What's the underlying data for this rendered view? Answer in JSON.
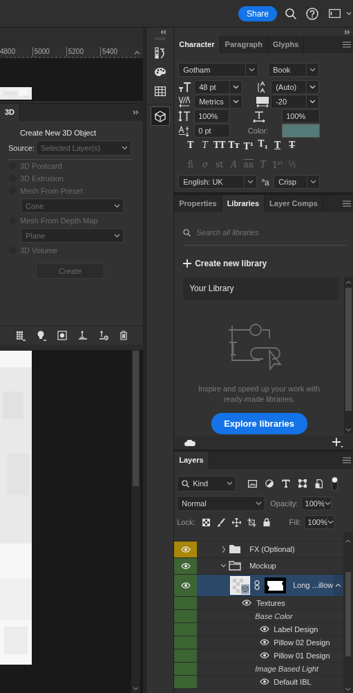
{
  "top_bar": {
    "share_button": "Share"
  },
  "document": {
    "ruler_ticks": [
      "4800",
      "5000",
      "5200",
      "5400"
    ]
  },
  "panel_3d": {
    "tab": "3D",
    "heading": "Create New 3D Object",
    "source_label": "Source:",
    "source": "Selected Layer(s)",
    "disabled": true,
    "options": [
      {
        "label": "3D Postcard",
        "selected": false
      },
      {
        "label": "3D Extrusion",
        "selected": false
      },
      {
        "label": "Mesh From Preset",
        "selected": false,
        "dropdown": "Cone"
      },
      {
        "label": "Mesh From Depth Map",
        "selected": false,
        "dropdown": "Plane"
      },
      {
        "label": "3D Volume",
        "selected": false
      }
    ],
    "create_button": "Create"
  },
  "dock": {
    "items": [
      {
        "kind": "history",
        "selected": false
      },
      {
        "kind": "swatches",
        "selected": false
      },
      {
        "kind": "grid",
        "selected": false
      },
      {
        "kind": "cube",
        "selected": true
      }
    ]
  },
  "character": {
    "tabs": [
      {
        "label": "Character",
        "selected": true
      },
      {
        "label": "Paragraph",
        "selected": false
      },
      {
        "label": "Glyphs",
        "selected": false
      }
    ],
    "font_family": "Gotham",
    "font_style": "Book",
    "size": "48 pt",
    "leading": "(Auto)",
    "kerning": "Metrics",
    "tracking": "-20",
    "vertical_scale": "100%",
    "horizontal_scale": "100%",
    "baseline_shift": "0 pt",
    "color_label": "Color:",
    "color": "#557a78",
    "style_buttons": [
      {
        "text": "T",
        "kind": "bold"
      },
      {
        "text": "T",
        "kind": "italic"
      },
      {
        "text": "TT",
        "kind": "plain"
      },
      {
        "text": "Tᴛ",
        "kind": "plain"
      },
      {
        "text": "T$^{1}$",
        "kind": "plain"
      },
      {
        "text": "T$_{1}$",
        "kind": "plain"
      },
      {
        "text": "T",
        "kind": "underline"
      },
      {
        "text": "T",
        "kind": "strike"
      }
    ],
    "opentype_disabled": true,
    "opentype_buttons": [
      {
        "text": "fi",
        "kind": "plain"
      },
      {
        "text": "ơ",
        "kind": "italic"
      },
      {
        "text": "st",
        "kind": "plain"
      },
      {
        "text": "A",
        "kind": "italic"
      },
      {
        "text": "aa",
        "kind": "overline"
      },
      {
        "text": "T",
        "kind": "italic"
      },
      {
        "text": "1$^{st}$",
        "kind": "plain"
      },
      {
        "text": "½",
        "kind": "plain"
      }
    ],
    "language": "English: UK",
    "antialias_label": "$^{a}$a",
    "antialias": "Crisp"
  },
  "libraries": {
    "tabs": [
      {
        "label": "Properties",
        "selected": false
      },
      {
        "label": "Libraries",
        "selected": true
      },
      {
        "label": "Layer Comps",
        "selected": false
      }
    ],
    "search_placeholder": "Search all libraries",
    "create_label": "Create new library",
    "libraries": [
      {
        "name": "Your Library"
      }
    ],
    "empty_message": "Inspire and speed up your work with ready-made libraries.",
    "explore_button": "Explore libraries"
  },
  "layers": {
    "tabs": [
      {
        "label": "Layers",
        "selected": true
      }
    ],
    "filter": "Kind",
    "filter_on": true,
    "blend_mode": "Normal",
    "opacity_label": "Opacity:",
    "opacity": "100%",
    "lock_label": "Lock:",
    "fill_label": "Fill:",
    "fill": "100%",
    "rows": [
      {
        "name": "FX (Optional)",
        "kind": "group",
        "selected": false,
        "expanded": false,
        "color": "#a8870a"
      },
      {
        "name": "Mockup",
        "kind": "group",
        "selected": false,
        "expanded": true,
        "color": "#3d6433",
        "children": [
          {
            "name": "Long ...illow",
            "kind": "model",
            "selected": true,
            "expanded": true,
            "children": [
              {
                "name": "Textures",
                "kind": "texture_group",
                "children": [
                  {
                    "name": "Base Color",
                    "kind": "heading",
                    "children": [
                      {
                        "name": "Label Design",
                        "kind": "texture"
                      },
                      {
                        "name": "Pillow 02 Design",
                        "kind": "texture"
                      },
                      {
                        "name": "Pillow 01 Design",
                        "kind": "texture"
                      }
                    ]
                  },
                  {
                    "name": "Image Based Light",
                    "kind": "heading",
                    "children": [
                      {
                        "name": "Default IBL",
                        "kind": "texture"
                      }
                    ]
                  }
                ]
              }
            ]
          }
        ]
      }
    ]
  }
}
